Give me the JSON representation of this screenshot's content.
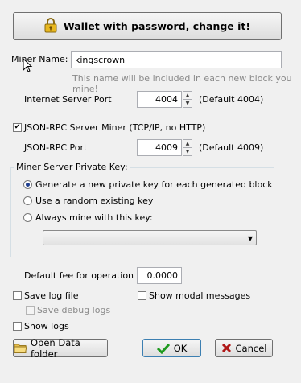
{
  "wallet_button": {
    "label": "Wallet with password, change it!",
    "icon": "padlock-icon"
  },
  "miner_name": {
    "label": "Miner Name:",
    "value": "kingscrown",
    "hint": "This name will be included in each new block you mine!"
  },
  "server_port": {
    "label": "Internet Server Port",
    "value": "4004",
    "default_text": "(Default 4004)"
  },
  "jsonrpc": {
    "checkbox_label": "JSON-RPC Server Miner (TCP/IP, no HTTP)",
    "checked": true,
    "port_label": "JSON-RPC Port",
    "port_value": "4009",
    "default_text": "(Default 4009)"
  },
  "private_key": {
    "title": "Miner Server Private Key:",
    "options": [
      "Generate a new private key for each generated block",
      "Use a random existing key",
      "Always mine with this key:"
    ],
    "selected_index": 0,
    "combo_value": ""
  },
  "fee": {
    "label": "Default fee for operation",
    "value": "0.0000"
  },
  "options": {
    "save_log": "Save log file",
    "show_modal": "Show modal messages",
    "save_debug": "Save debug logs",
    "show_logs": "Show logs"
  },
  "buttons": {
    "open_folder": "Open Data folder",
    "ok": "OK",
    "cancel": "Cancel"
  },
  "colors": {
    "ok_check": "#1e9a1e",
    "cancel_x": "#b01818",
    "lock": "#e0b020"
  }
}
